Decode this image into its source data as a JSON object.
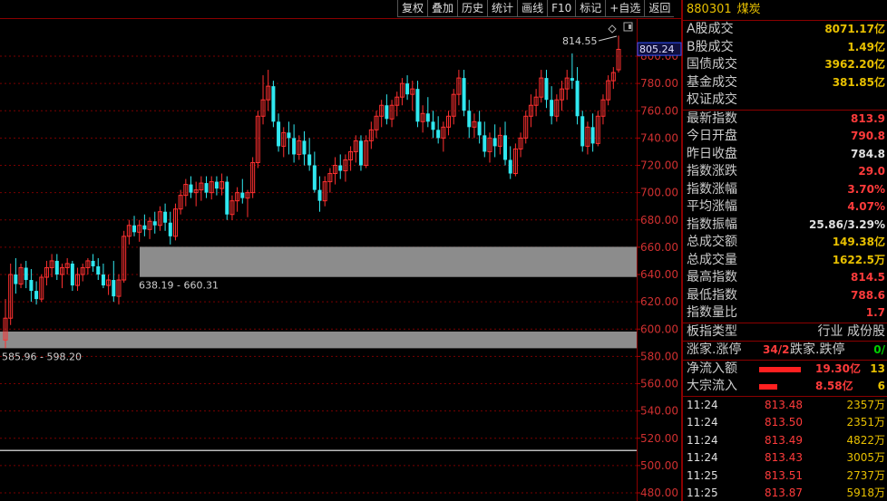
{
  "toolbar": [
    "复权",
    "叠加",
    "历史",
    "统计",
    "画线",
    "F10",
    "标记",
    "+自选",
    "返回"
  ],
  "header": {
    "code": "880301",
    "name": "煤炭"
  },
  "stats_a": [
    {
      "label": "A股成交",
      "value": "8071.17亿",
      "color": "y"
    },
    {
      "label": "B股成交",
      "value": "1.49亿",
      "color": "y"
    },
    {
      "label": "国债成交",
      "value": "3962.20亿",
      "color": "y"
    },
    {
      "label": "基金成交",
      "value": "381.85亿",
      "color": "y"
    },
    {
      "label": "权证成交",
      "value": "",
      "color": "y"
    }
  ],
  "stats_b": [
    {
      "label": "最新指数",
      "value": "813.9",
      "color": "r"
    },
    {
      "label": "今日开盘",
      "value": "790.8",
      "color": "r"
    },
    {
      "label": "昨日收盘",
      "value": "784.8",
      "color": "w"
    },
    {
      "label": "指数涨跌",
      "value": "29.0",
      "color": "r"
    },
    {
      "label": "指数涨幅",
      "value": "3.70%",
      "color": "r"
    },
    {
      "label": "平均涨幅",
      "value": "4.07%",
      "color": "r"
    },
    {
      "label": "指数振幅",
      "value": "25.86/3.29%",
      "color": "w"
    },
    {
      "label": "总成交额",
      "value": "149.38亿",
      "color": "y"
    },
    {
      "label": "总成交量",
      "value": "1622.5万",
      "color": "y"
    },
    {
      "label": "最高指数",
      "value": "814.5",
      "color": "r"
    },
    {
      "label": "最低指数",
      "value": "788.6",
      "color": "r"
    },
    {
      "label": "指数量比",
      "value": "1.7",
      "color": "r"
    }
  ],
  "index_type": {
    "label": "板指类型",
    "value": "行业 成份股"
  },
  "breadth": {
    "label": "涨家.涨停",
    "value": "34/2",
    "label2": "跌家.跌停",
    "value2": "0/"
  },
  "flows": [
    {
      "label": "净流入额",
      "value": "19.30亿",
      "extra": "13",
      "bar": 46
    },
    {
      "label": "大宗流入",
      "value": "8.58亿",
      "extra": "6",
      "bar": 20
    }
  ],
  "ticks": [
    {
      "time": "11:24",
      "price": "813.48",
      "vol": "2357万"
    },
    {
      "time": "11:24",
      "price": "813.50",
      "vol": "2351万"
    },
    {
      "time": "11:24",
      "price": "813.49",
      "vol": "4822万"
    },
    {
      "time": "11:24",
      "price": "813.43",
      "vol": "3005万"
    },
    {
      "time": "11:25",
      "price": "813.51",
      "vol": "2737万"
    },
    {
      "time": "11:25",
      "price": "813.87",
      "vol": "5918万"
    }
  ],
  "chart_data": {
    "type": "candlestick",
    "y_axis_ticks": [
      800,
      780,
      760,
      740,
      720,
      700,
      680,
      660,
      640,
      620,
      600,
      580,
      560,
      540,
      520,
      500,
      480
    ],
    "ylim": [
      475,
      820
    ],
    "current_price": "805.24",
    "high_annotation": "814.55",
    "gaps": [
      {
        "label": "638.19 - 660.31",
        "low": 638.19,
        "high": 660.31
      },
      {
        "label": "585.96 - 598.20",
        "low": 585.96,
        "high": 598.2
      }
    ],
    "horizontal_line": 511,
    "candles": [
      [
        592,
        622,
        586,
        608
      ],
      [
        608,
        648,
        603,
        640
      ],
      [
        640,
        652,
        626,
        633
      ],
      [
        633,
        648,
        630,
        645
      ],
      [
        645,
        650,
        630,
        636
      ],
      [
        636,
        644,
        620,
        628
      ],
      [
        628,
        635,
        618,
        622
      ],
      [
        622,
        640,
        620,
        638
      ],
      [
        638,
        650,
        632,
        645
      ],
      [
        645,
        655,
        638,
        650
      ],
      [
        650,
        655,
        636,
        640
      ],
      [
        640,
        648,
        630,
        645
      ],
      [
        645,
        652,
        640,
        648
      ],
      [
        648,
        650,
        628,
        632
      ],
      [
        632,
        645,
        628,
        640
      ],
      [
        640,
        648,
        635,
        645
      ],
      [
        645,
        652,
        640,
        650
      ],
      [
        650,
        655,
        642,
        646
      ],
      [
        646,
        652,
        636,
        640
      ],
      [
        640,
        648,
        630,
        632
      ],
      [
        632,
        640,
        625,
        636
      ],
      [
        636,
        650,
        620,
        624
      ],
      [
        624,
        640,
        618,
        636
      ],
      [
        636,
        672,
        634,
        668
      ],
      [
        668,
        680,
        662,
        676
      ],
      [
        676,
        683,
        668,
        671
      ],
      [
        671,
        680,
        664,
        676
      ],
      [
        676,
        684,
        668,
        673
      ],
      [
        673,
        682,
        666,
        679
      ],
      [
        679,
        686,
        670,
        676
      ],
      [
        676,
        690,
        672,
        686
      ],
      [
        686,
        692,
        672,
        678
      ],
      [
        678,
        686,
        662,
        668
      ],
      [
        668,
        692,
        665,
        688
      ],
      [
        688,
        702,
        684,
        698
      ],
      [
        698,
        710,
        690,
        706
      ],
      [
        706,
        712,
        696,
        700
      ],
      [
        700,
        708,
        690,
        702
      ],
      [
        702,
        712,
        694,
        707
      ],
      [
        707,
        712,
        696,
        700
      ],
      [
        700,
        712,
        695,
        708
      ],
      [
        708,
        712,
        698,
        703
      ],
      [
        703,
        714,
        698,
        708
      ],
      [
        708,
        712,
        680,
        684
      ],
      [
        684,
        698,
        680,
        694
      ],
      [
        694,
        704,
        686,
        700
      ],
      [
        700,
        710,
        692,
        696
      ],
      [
        696,
        702,
        682,
        700
      ],
      [
        700,
        726,
        696,
        722
      ],
      [
        722,
        760,
        718,
        756
      ],
      [
        756,
        786,
        750,
        768
      ],
      [
        768,
        790,
        760,
        778
      ],
      [
        778,
        782,
        748,
        752
      ],
      [
        752,
        758,
        730,
        734
      ],
      [
        734,
        748,
        726,
        744
      ],
      [
        744,
        752,
        728,
        740
      ],
      [
        740,
        750,
        722,
        728
      ],
      [
        728,
        742,
        724,
        738
      ],
      [
        738,
        745,
        720,
        728
      ],
      [
        728,
        740,
        716,
        720
      ],
      [
        720,
        730,
        700,
        702
      ],
      [
        702,
        712,
        686,
        694
      ],
      [
        694,
        712,
        690,
        708
      ],
      [
        708,
        718,
        700,
        714
      ],
      [
        714,
        726,
        706,
        720
      ],
      [
        720,
        728,
        710,
        716
      ],
      [
        716,
        728,
        708,
        724
      ],
      [
        724,
        734,
        716,
        730
      ],
      [
        730,
        742,
        722,
        738
      ],
      [
        738,
        742,
        716,
        720
      ],
      [
        720,
        742,
        718,
        738
      ],
      [
        738,
        752,
        732,
        746
      ],
      [
        746,
        760,
        740,
        756
      ],
      [
        756,
        768,
        748,
        764
      ],
      [
        764,
        772,
        750,
        754
      ],
      [
        754,
        768,
        748,
        764
      ],
      [
        764,
        774,
        756,
        770
      ],
      [
        770,
        784,
        764,
        780
      ],
      [
        780,
        786,
        768,
        772
      ],
      [
        772,
        782,
        760,
        776
      ],
      [
        776,
        782,
        748,
        752
      ],
      [
        752,
        764,
        744,
        758
      ],
      [
        758,
        770,
        748,
        752
      ],
      [
        752,
        760,
        740,
        746
      ],
      [
        746,
        756,
        736,
        740
      ],
      [
        740,
        752,
        730,
        748
      ],
      [
        748,
        760,
        742,
        756
      ],
      [
        756,
        776,
        750,
        772
      ],
      [
        772,
        790,
        764,
        784
      ],
      [
        784,
        790,
        756,
        760
      ],
      [
        760,
        768,
        740,
        748
      ],
      [
        748,
        758,
        740,
        752
      ],
      [
        752,
        760,
        736,
        742
      ],
      [
        742,
        752,
        726,
        730
      ],
      [
        730,
        744,
        722,
        740
      ],
      [
        740,
        750,
        726,
        734
      ],
      [
        734,
        748,
        728,
        742
      ],
      [
        742,
        752,
        720,
        724
      ],
      [
        724,
        734,
        710,
        714
      ],
      [
        714,
        736,
        712,
        732
      ],
      [
        732,
        744,
        726,
        740
      ],
      [
        740,
        760,
        736,
        756
      ],
      [
        756,
        772,
        748,
        764
      ],
      [
        764,
        776,
        756,
        770
      ],
      [
        770,
        790,
        766,
        784
      ],
      [
        784,
        790,
        762,
        768
      ],
      [
        768,
        778,
        750,
        756
      ],
      [
        756,
        772,
        752,
        768
      ],
      [
        768,
        782,
        760,
        776
      ],
      [
        776,
        790,
        768,
        784
      ],
      [
        784,
        802,
        776,
        782
      ],
      [
        782,
        792,
        750,
        756
      ],
      [
        756,
        760,
        730,
        734
      ],
      [
        734,
        752,
        728,
        748
      ],
      [
        748,
        758,
        730,
        736
      ],
      [
        736,
        760,
        734,
        756
      ],
      [
        756,
        772,
        750,
        768
      ],
      [
        768,
        786,
        764,
        782
      ],
      [
        782,
        792,
        776,
        788
      ],
      [
        790,
        815,
        788,
        805
      ]
    ]
  }
}
